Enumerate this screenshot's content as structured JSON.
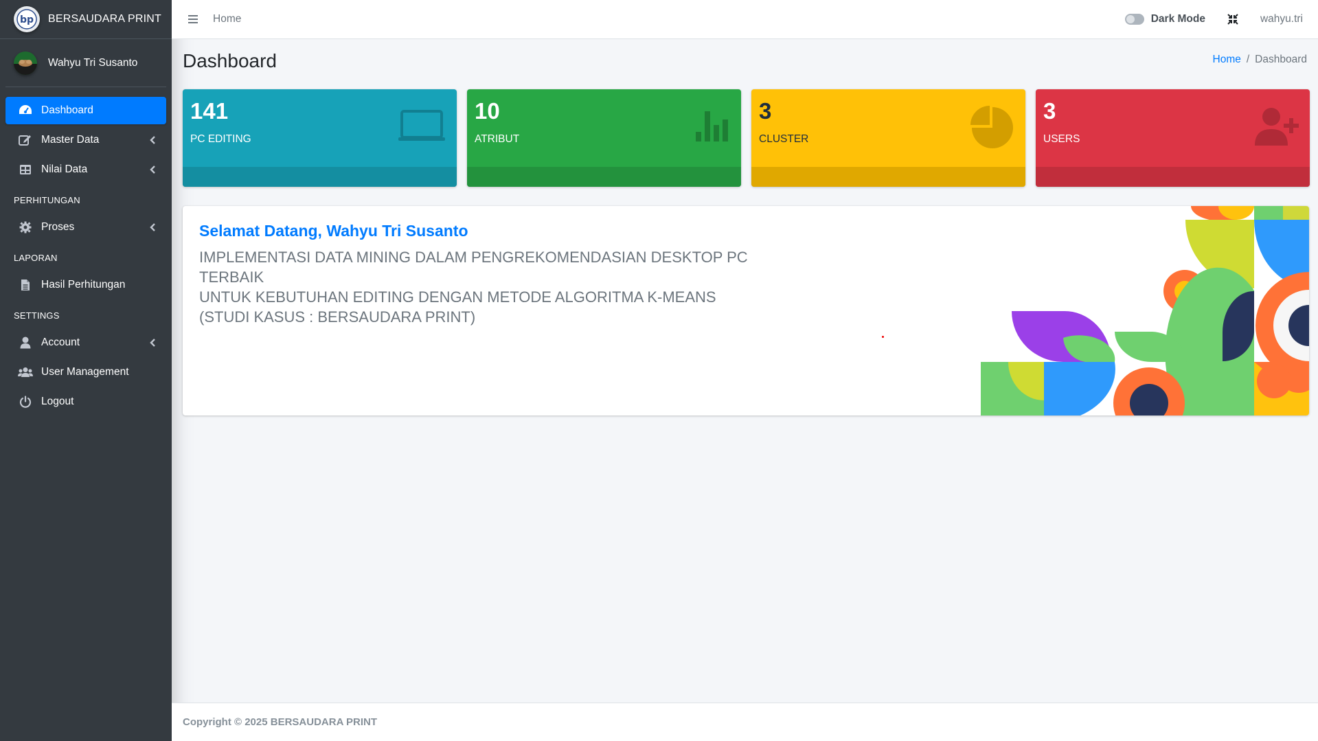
{
  "brand": {
    "name": "BERSAUDARA PRINT",
    "logo_icon": "bp-logo"
  },
  "user_panel": {
    "name": "Wahyu Tri Susanto",
    "avatar_icon": "user-avatar"
  },
  "sidebar": {
    "items": [
      {
        "label": "Dashboard",
        "icon": "dashboard-icon",
        "active": true
      },
      {
        "label": "Master Data",
        "icon": "edit-icon",
        "chevron": true
      },
      {
        "label": "Nilai Data",
        "icon": "table-icon",
        "chevron": true
      }
    ],
    "header_perhitungan": "PERHITUNGAN",
    "perhitungan_items": [
      {
        "label": "Proses",
        "icon": "gear-icon",
        "chevron": true
      }
    ],
    "header_laporan": "LAPORAN",
    "laporan_items": [
      {
        "label": "Hasil Perhitungan",
        "icon": "document-icon"
      }
    ],
    "header_settings": "SETTINGS",
    "settings_items": [
      {
        "label": "Account",
        "icon": "user-icon",
        "chevron": true
      },
      {
        "label": "User Management",
        "icon": "users-icon"
      },
      {
        "label": "Logout",
        "icon": "power-icon"
      }
    ]
  },
  "topbar": {
    "home_label": "Home",
    "dark_mode_label": "Dark Mode",
    "username": "wahyu.tri"
  },
  "page": {
    "title": "Dashboard",
    "breadcrumb": {
      "home": "Home",
      "separator": "/",
      "current": "Dashboard"
    }
  },
  "stats": [
    {
      "value": "141",
      "label": "PC EDITING",
      "color": "#17a2b8",
      "icon": "laptop-icon"
    },
    {
      "value": "10",
      "label": "ATRIBUT",
      "color": "#28a745",
      "icon": "bar-chart-icon"
    },
    {
      "value": "3",
      "label": "CLUSTER",
      "color": "#ffc107",
      "icon": "pie-chart-icon"
    },
    {
      "value": "3",
      "label": "USERS",
      "color": "#dc3545",
      "icon": "user-plus-icon"
    }
  ],
  "welcome": {
    "title": "Selamat Datang, Wahyu Tri Susanto",
    "line1": "IMPLEMENTASI DATA MINING DALAM PENGREKOMENDASIAN DESKTOP PC TERBAIK",
    "line2": "UNTUK KEBUTUHAN EDITING DENGAN METODE ALGORITMA K-MEANS",
    "line3": "(STUDI KASUS : BERSAUDARA PRINT)"
  },
  "footer": {
    "text": "Copyright © 2025 BERSAUDARA PRINT"
  },
  "colors": {
    "primary": "#007bff",
    "sidebar_bg": "#343a40",
    "page_bg": "#f4f6f9"
  }
}
